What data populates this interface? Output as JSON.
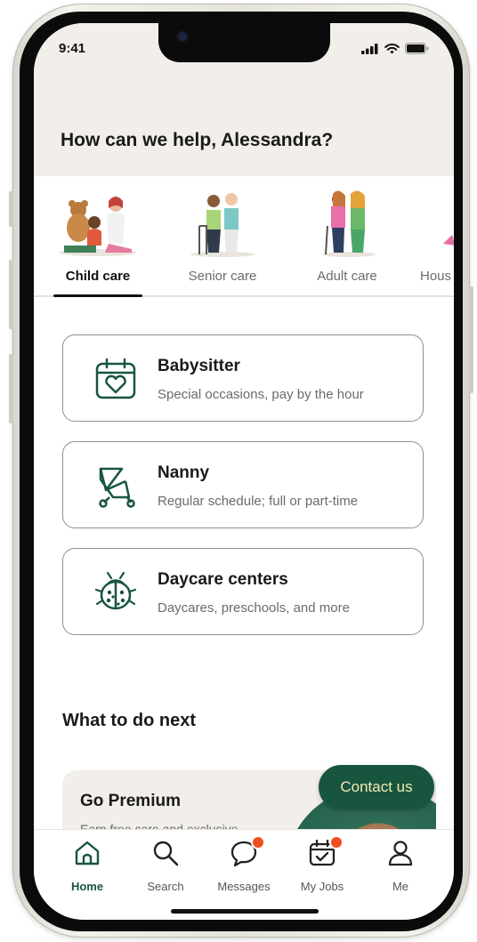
{
  "status_bar": {
    "time": "9:41"
  },
  "greeting": "How can we help, Alessandra?",
  "categories": [
    {
      "label": "Child care",
      "active": true
    },
    {
      "label": "Senior care",
      "active": false
    },
    {
      "label": "Adult care",
      "active": false
    },
    {
      "label": "Hous",
      "active": false
    }
  ],
  "services": [
    {
      "title": "Babysitter",
      "subtitle": "Special occasions, pay by the hour",
      "icon": "calendar-heart-icon"
    },
    {
      "title": "Nanny",
      "subtitle": "Regular schedule; full or part-time",
      "icon": "stroller-icon"
    },
    {
      "title": "Daycare centers",
      "subtitle": "Daycares, preschools, and more",
      "icon": "ladybug-icon"
    }
  ],
  "next_section_title": "What to do next",
  "premium": {
    "title": "Go Premium",
    "subtitle": "Earn free care and exclusive"
  },
  "contact_button": "Contact us",
  "nav": [
    {
      "label": "Home",
      "icon": "home-icon",
      "active": true,
      "badge": false
    },
    {
      "label": "Search",
      "icon": "search-icon",
      "active": false,
      "badge": false
    },
    {
      "label": "Messages",
      "icon": "message-icon",
      "active": false,
      "badge": true
    },
    {
      "label": "My Jobs",
      "icon": "jobs-calendar-icon",
      "active": false,
      "badge": true
    },
    {
      "label": "Me",
      "icon": "profile-icon",
      "active": false,
      "badge": false
    }
  ],
  "colors": {
    "brand_green": "#18553f",
    "badge_orange": "#f04e1e",
    "header_bg": "#f2efea",
    "contact_text": "#f4e9b0"
  }
}
